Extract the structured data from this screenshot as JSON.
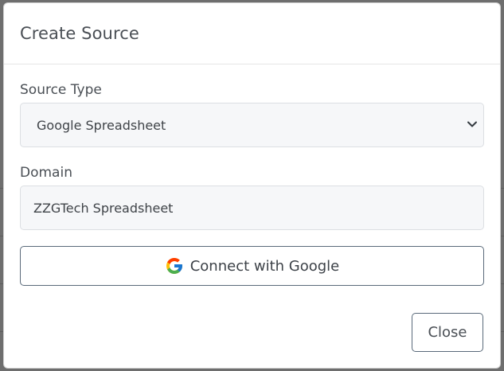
{
  "modal": {
    "title": "Create Source",
    "source_type": {
      "label": "Source Type",
      "selected": "Google Spreadsheet"
    },
    "domain": {
      "label": "Domain",
      "value": "ZZGTech Spreadsheet"
    },
    "connect_button": {
      "label": "Connect with Google",
      "icon": "google-icon"
    },
    "close_button": {
      "label": "Close"
    }
  },
  "colors": {
    "overlay": "#6e6e6e",
    "input_bg": "#f6f7f9",
    "button_border": "#5a6a7a",
    "text": "#4a4f55"
  }
}
